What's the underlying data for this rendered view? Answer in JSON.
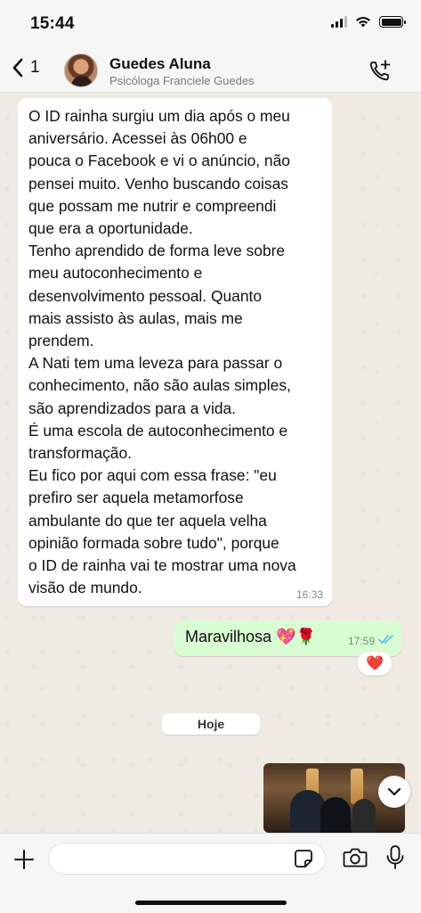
{
  "status_bar": {
    "time": "15:44"
  },
  "header": {
    "back_count": "1",
    "contact_name": "Guedes Aluna",
    "contact_subtitle": "Psicóloga Franciele Guedes"
  },
  "messages": {
    "incoming": {
      "text": "O ID rainha surgiu um dia após o meu\naniversário. Acessei às 06h00 e\npouca o Facebook e vi o anúncio, não\npensei muito. Venho buscando coisas\nque possam me nutrir e compreendi\nque era a oportunidade.\nTenho aprendido de forma leve sobre\nmeu autoconhecimento e\ndesenvolvimento pessoal. Quanto\nmais assisto às aulas, mais me\nprendem.\nA Nati tem uma leveza para passar o\nconhecimento, não são aulas simples,\nsão aprendizados para a vida.\nÉ uma escola de autoconhecimento e\ntransformação.\nEu fico por aqui com essa frase: \"eu\nprefiro ser aquela metamorfose\nambulante do que ter aquela velha\nopinião formada sobre tudo\", porque\no ID de rainha vai te mostrar uma nova\nvisão de mundo.",
      "time": "16:33"
    },
    "outgoing": {
      "text": "Maravilhosa 💖🌹",
      "time": "17:59",
      "reaction": "❤️"
    },
    "date_divider": "Hoje"
  },
  "input": {
    "value": "",
    "placeholder": ""
  },
  "colors": {
    "incoming_bubble": "#ffffff",
    "outgoing_bubble": "#d9fdd3",
    "read_ticks": "#53bdeb",
    "wallpaper": "#efeae2"
  },
  "icons": [
    "back-chevron-icon",
    "add-call-icon",
    "read-ticks-icon",
    "chevron-down-icon",
    "plus-icon",
    "sticker-icon",
    "camera-icon",
    "mic-icon"
  ]
}
